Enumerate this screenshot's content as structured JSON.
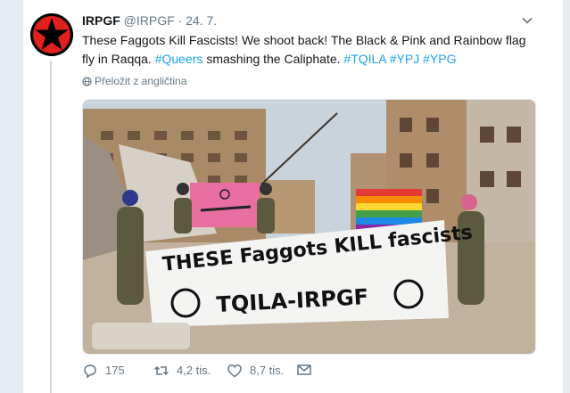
{
  "tweet": {
    "display_name": "IRPGF",
    "handle": "@IRPGF",
    "separator": "·",
    "date": "24. 7.",
    "text_parts": {
      "p1": "These Faggots Kill Fascists! We shoot back! The Black & Pink and Rainbow flag fly in Raqqa.",
      "h1": "#Queers",
      "p2": "smashing the Caliphate.",
      "h2": "#TQILA",
      "h3": "#YPJ",
      "h4": "#YPG"
    },
    "translate_label": "Přeložit z angličtina"
  },
  "banner": {
    "line1": "THESE Faggots KILL fascists",
    "line2": "TQILA-IRPGF"
  },
  "actions": {
    "reply_count": "175",
    "retweet_count": "4,2 tis.",
    "like_count": "8,7 tis."
  },
  "icons": {
    "avatar": "red-star-icon",
    "caret": "chevron-down-icon",
    "translate": "globe-icon",
    "reply": "reply-icon",
    "retweet": "retweet-icon",
    "like": "heart-icon",
    "dm": "envelope-icon"
  },
  "colors": {
    "accent": "#1da1f2",
    "muted": "#657786",
    "avatar_star": "#e0211b"
  }
}
